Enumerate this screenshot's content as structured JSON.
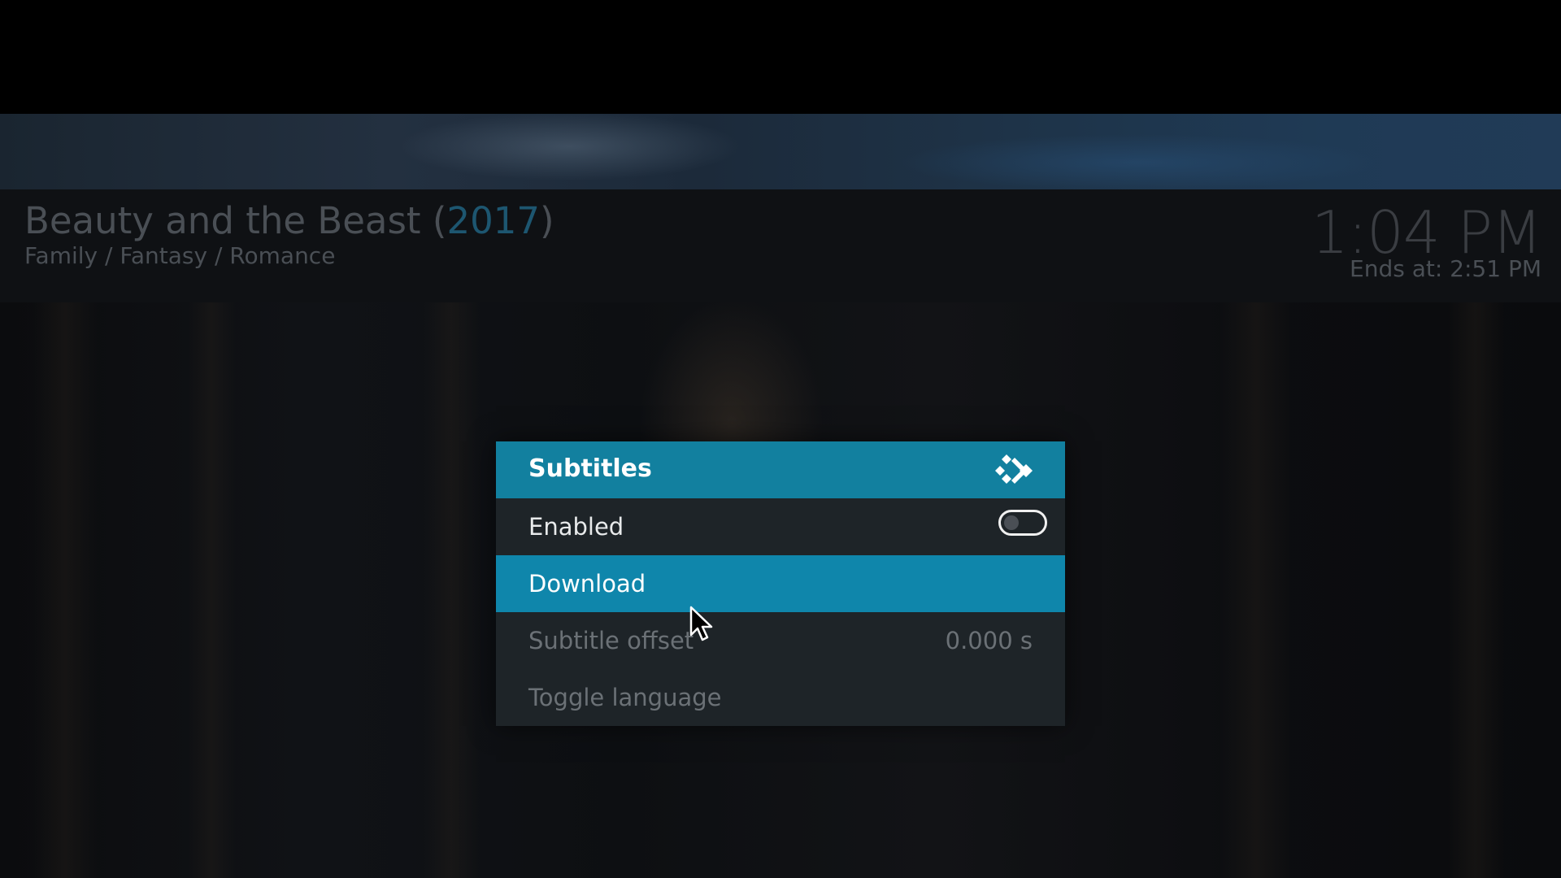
{
  "movie": {
    "title": "Beauty and the Beast (",
    "year": "2017",
    "title_close": ")",
    "genres": "Family / Fantasy / Romance"
  },
  "clock": {
    "time": "1:04 PM",
    "ends": "Ends at: 2:51 PM"
  },
  "dialog": {
    "title": "Subtitles",
    "logo_icon": "kodi-logo-icon",
    "items": [
      {
        "label": "Enabled",
        "control": "toggle",
        "toggle_on": false,
        "state": "normal"
      },
      {
        "label": "Download",
        "state": "focused"
      },
      {
        "label": "Subtitle offset",
        "value": "0.000 s",
        "state": "disabled"
      },
      {
        "label": "Toggle language",
        "state": "disabled"
      }
    ]
  },
  "colors": {
    "accent": "#12809f",
    "focused_row": "#0f86ab",
    "dialog_bg": "#1e2428",
    "year_color": "#1d5670"
  },
  "pointer_icon": "mouse-pointer-icon"
}
